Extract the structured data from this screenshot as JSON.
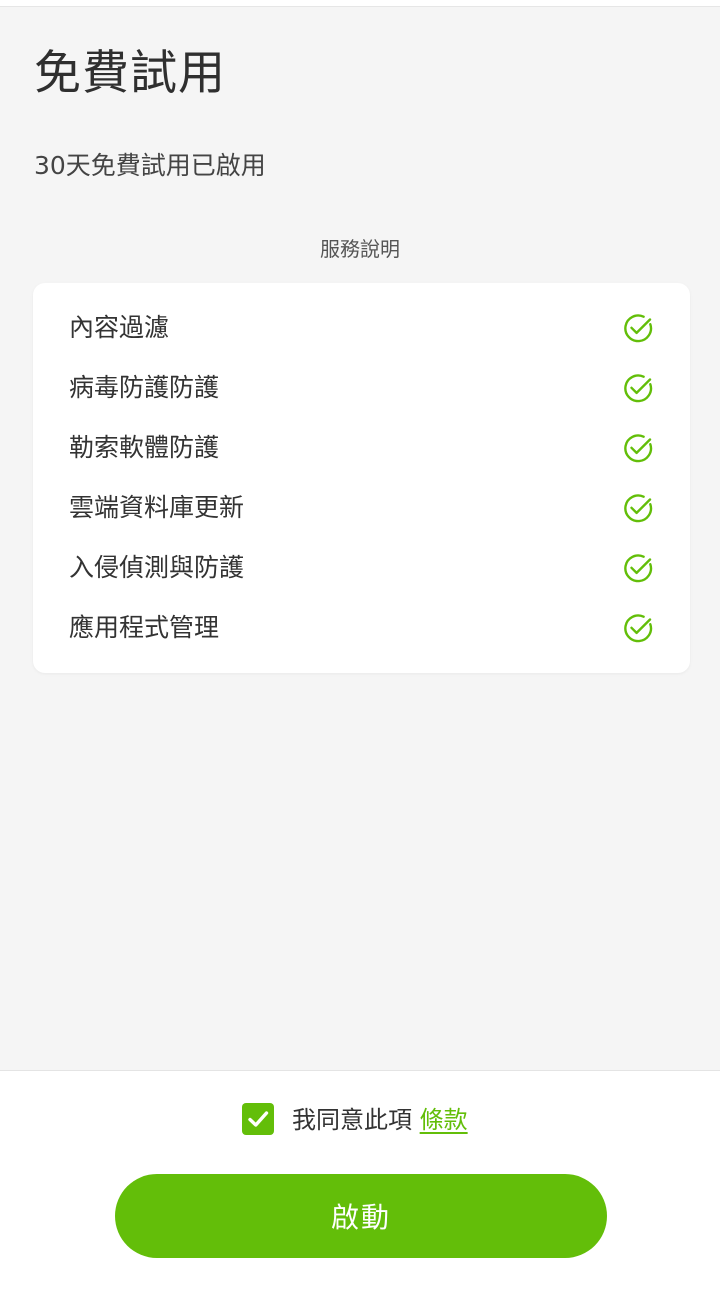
{
  "header": {
    "title": "免費試用",
    "subtitle": "30天免費試用已啟用"
  },
  "services": {
    "section_title": "服務說明",
    "items": [
      {
        "label": "內容過濾",
        "icon": "check-circle-icon",
        "enabled": true
      },
      {
        "label": "病毒防護防護",
        "icon": "check-circle-icon",
        "enabled": true
      },
      {
        "label": "勒索軟體防護",
        "icon": "check-circle-icon",
        "enabled": true
      },
      {
        "label": "雲端資料庫更新",
        "icon": "check-circle-icon",
        "enabled": true
      },
      {
        "label": "入侵偵測與防護",
        "icon": "check-circle-icon",
        "enabled": true
      },
      {
        "label": "應用程式管理",
        "icon": "check-circle-icon",
        "enabled": true
      }
    ]
  },
  "footer": {
    "agree_checked": true,
    "agree_text": "我同意此項 ",
    "terms_link": "條款",
    "activate_label": "啟動"
  },
  "colors": {
    "accent": "#63be09",
    "background": "#f5f5f5",
    "card": "#ffffff",
    "text": "#333333"
  }
}
